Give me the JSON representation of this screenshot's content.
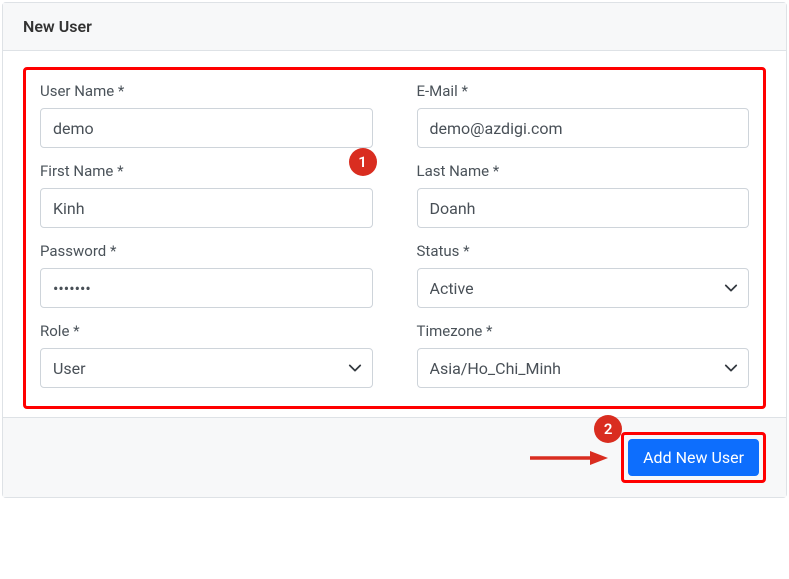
{
  "header": {
    "title": "New User"
  },
  "form": {
    "username": {
      "label": "User Name *",
      "value": "demo"
    },
    "email": {
      "label": "E-Mail *",
      "value": "demo@azdigi.com"
    },
    "firstname": {
      "label": "First Name *",
      "value": "Kinh"
    },
    "lastname": {
      "label": "Last Name *",
      "value": "Doanh"
    },
    "password": {
      "label": "Password *",
      "value": "•••••••"
    },
    "status": {
      "label": "Status *",
      "value": "Active"
    },
    "role": {
      "label": "Role *",
      "value": "User"
    },
    "timezone": {
      "label": "Timezone *",
      "value": "Asia/Ho_Chi_Minh"
    }
  },
  "footer": {
    "submit_label": "Add New User"
  },
  "annotations": {
    "badge1": "1",
    "badge2": "2"
  }
}
